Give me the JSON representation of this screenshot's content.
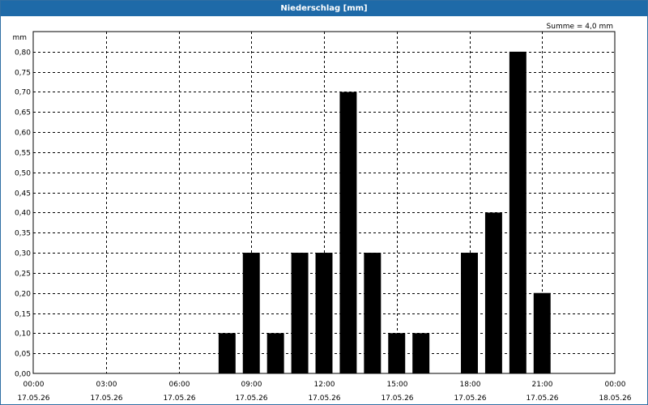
{
  "window": {
    "title": "Niederschlag [mm]"
  },
  "summary": "Summe = 4,0 mm",
  "colors": {
    "titlebar": "#1e6aa8",
    "bars": "#000000",
    "grid": "#000000"
  },
  "chart_data": {
    "type": "bar",
    "title": "Niederschlag [mm]",
    "ylabel": "mm",
    "xlabel": "",
    "ylim": [
      0,
      0.85
    ],
    "yticks": [
      0.0,
      0.05,
      0.1,
      0.15,
      0.2,
      0.25,
      0.3,
      0.35,
      0.4,
      0.45,
      0.5,
      0.55,
      0.6,
      0.65,
      0.7,
      0.75,
      0.8
    ],
    "ytick_labels": [
      "0,00",
      "0,05",
      "0,10",
      "0,15",
      "0,20",
      "0,25",
      "0,30",
      "0,35",
      "0,40",
      "0,45",
      "0,50",
      "0,55",
      "0,60",
      "0,65",
      "0,70",
      "0,75",
      "0,80"
    ],
    "xlim_hours": [
      0,
      24
    ],
    "xticks": [
      {
        "hour": 0,
        "time": "00:00",
        "date": "17.05.26"
      },
      {
        "hour": 3,
        "time": "03:00",
        "date": "17.05.26"
      },
      {
        "hour": 6,
        "time": "06:00",
        "date": "17.05.26"
      },
      {
        "hour": 9,
        "time": "09:00",
        "date": "17.05.26"
      },
      {
        "hour": 12,
        "time": "12:00",
        "date": "17.05.26"
      },
      {
        "hour": 15,
        "time": "15:00",
        "date": "17.05.26"
      },
      {
        "hour": 18,
        "time": "18:00",
        "date": "17.05.26"
      },
      {
        "hour": 21,
        "time": "21:00",
        "date": "17.05.26"
      },
      {
        "hour": 24,
        "time": "00:00",
        "date": "18.05.26"
      }
    ],
    "bar_hours": [
      8,
      9,
      10,
      11,
      12,
      13,
      14,
      15,
      16,
      17,
      18,
      19,
      20,
      21
    ],
    "values": [
      0.1,
      0.3,
      0.1,
      0.3,
      0.3,
      0.7,
      0.3,
      0.1,
      0.1,
      0,
      0.3,
      0.4,
      0.8,
      0.2
    ],
    "grid": true,
    "sum_annotation": "Summe = 4,0 mm"
  }
}
